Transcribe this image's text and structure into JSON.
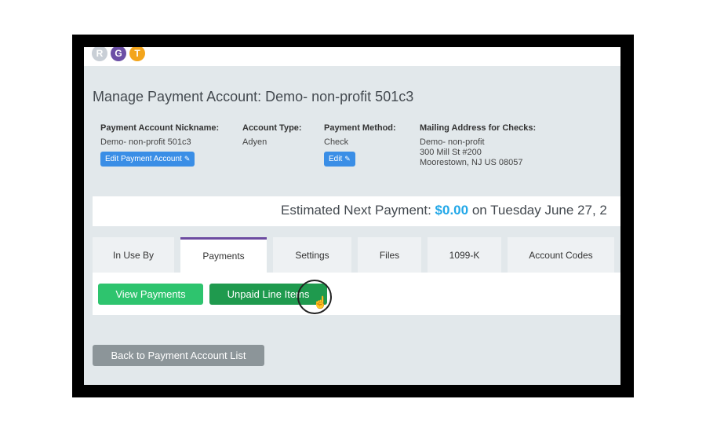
{
  "logo": {
    "letters": [
      "R",
      "G",
      "T"
    ],
    "colors": [
      "#c9cfd6",
      "#6b4fa5",
      "#f3a51c"
    ]
  },
  "page_title": "Manage Payment Account: Demo- non-profit 501c3",
  "info": {
    "nickname_label": "Payment Account Nickname:",
    "nickname_value": "Demo- non-profit 501c3",
    "edit_account_label": "Edit Payment Account",
    "account_type_label": "Account Type:",
    "account_type_value": "Adyen",
    "method_label": "Payment Method:",
    "method_value": "Check",
    "edit_label": "Edit",
    "address_label": "Mailing Address for Checks:",
    "address_line1": "Demo- non-profit",
    "address_line2": "300 Mill St #200",
    "address_line3": "Moorestown, NJ US 08057"
  },
  "estimate": {
    "prefix": "Estimated Next Payment:",
    "amount": "$0.00",
    "suffix": "on Tuesday June 27, 2"
  },
  "tabs": [
    {
      "label": "In Use By"
    },
    {
      "label": "Payments",
      "active": true
    },
    {
      "label": "Settings"
    },
    {
      "label": "Files"
    },
    {
      "label": "1099-K"
    },
    {
      "label": "Account Codes"
    }
  ],
  "actions": {
    "view_payments": "View Payments",
    "unpaid_line_items": "Unpaid Line Items",
    "back_to_list": "Back to Payment Account List"
  },
  "colors": {
    "accent_blue": "#3a8ee6",
    "amount_blue": "#23a8e8",
    "green_light": "#2ec46e",
    "green_dark": "#1f9a4e",
    "active_tab_purple": "#6c4ba0",
    "back_gray": "#8c9599"
  },
  "icons": {
    "edit": "edit-icon",
    "cursor": "hand-pointer-icon"
  }
}
